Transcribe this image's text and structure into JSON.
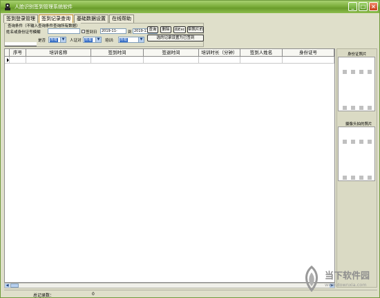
{
  "window": {
    "title": "人脸识别签到管理系统软件",
    "minimize_label": "_",
    "maximize_label": "□",
    "close_label": "×"
  },
  "tabs": [
    {
      "label": "签到登录管理",
      "active": false
    },
    {
      "label": "签到记录查询",
      "active": true
    },
    {
      "label": "基础数据设置",
      "active": false
    },
    {
      "label": "在线帮助",
      "active": false
    }
  ],
  "filter": {
    "legend": "查询条件（不输入查询条件查询所有数据）",
    "name_id_label": "姓名或身份证号模糊",
    "date_label": "签到日",
    "date_from": "2019-11-",
    "date_to_label": "到",
    "date_to": "2019-11-",
    "query_button": "查询",
    "delete_button": "删除",
    "export_button": "出Exc",
    "with_photo_button": "带照片的Ex",
    "late_label": "是否",
    "late_value": "所有",
    "idcard_label": "人证对",
    "idcard_value": "所有",
    "training_label": "培训:",
    "training_value": "所有",
    "set_selected_button": "选的记录设置为已签到"
  },
  "grid": {
    "columns": [
      "序号",
      "培训名称",
      "签到时间",
      "签退时间",
      "培训时长（分钟）",
      "签到人姓名",
      "身份证号"
    ],
    "rows": [
      [
        "",
        "",
        "",
        "",
        "",
        "",
        ""
      ]
    ]
  },
  "scroll": {
    "left_arrow": "◀",
    "right_arrow": "▶"
  },
  "status": {
    "total_label": "总记录数：",
    "total_value": "0"
  },
  "side": {
    "idcard_photo_label": "身份证照片",
    "camera_photo_label": "摄像头拍的照片"
  },
  "watermark": {
    "title": "当下软件园",
    "subtitle": "www.downxia.com"
  },
  "colors": {
    "titlebar": "#7cae3c",
    "selection": "#316ac5",
    "background": "#dfdfca"
  }
}
